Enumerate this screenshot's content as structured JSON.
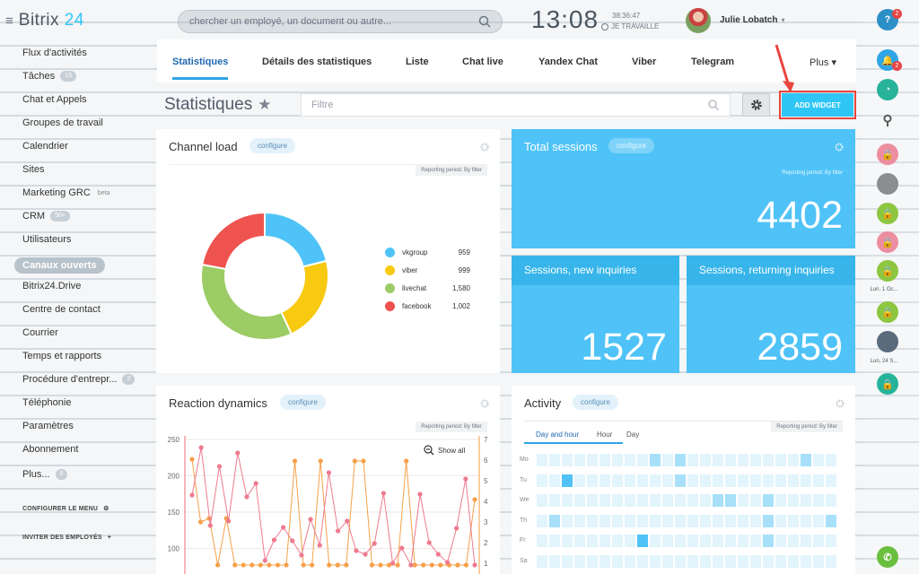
{
  "header": {
    "logo_word": "Bitrix",
    "logo_num": "24",
    "search_placeholder": "chercher un employé, un document ou autre...",
    "clock": "13:08",
    "seconds": "38:36:47",
    "work_status": "JE TRAVAILLE",
    "user_name": "Julie Lobatch"
  },
  "menu": {
    "items": [
      {
        "label": "Flux d'activités"
      },
      {
        "label": "Tâches",
        "count": "13"
      },
      {
        "label": "Chat et Appels"
      },
      {
        "label": "Groupes de travail"
      },
      {
        "label": "Calendrier"
      },
      {
        "label": "Sites"
      },
      {
        "label": "Marketing GRC",
        "sup": "beta"
      },
      {
        "label": "CRM",
        "count": "50+"
      },
      {
        "label": "Utilisateurs"
      },
      {
        "label": "Canaux ouverts",
        "active": true
      },
      {
        "label": "Bitrix24.Drive"
      },
      {
        "label": "Centre de contact"
      },
      {
        "label": "Courrier"
      },
      {
        "label": "Temps et rapports"
      },
      {
        "label": "Procédure d'entrepr...",
        "count": "2"
      },
      {
        "label": "Téléphonie"
      },
      {
        "label": "Paramètres"
      },
      {
        "label": "Abonnement"
      },
      {
        "label": "Plus...",
        "count": "8"
      }
    ],
    "configure": "CONFIGURER LE MENU",
    "invite": "INVITER DES EMPLOYÉS"
  },
  "tabs": [
    "Statistiques",
    "Détails des statistiques",
    "Liste",
    "Chat live",
    "Yandex Chat",
    "Viber",
    "Telegram",
    "Plus"
  ],
  "toolbar": {
    "title": "Statistiques",
    "filter_placeholder": "Filtre",
    "add_widget": "ADD WIDGET"
  },
  "widgets": {
    "configure": "configure",
    "reporting": "Reporting period: By filter",
    "channel_load": {
      "title": "Channel load",
      "legend": [
        {
          "name": "vkgroup",
          "value": "959",
          "color": "#4fc3f7"
        },
        {
          "name": "viber",
          "value": "999",
          "color": "#f7c910"
        },
        {
          "name": "livechat",
          "value": "1,580",
          "color": "#9ccc65"
        },
        {
          "name": "facebook",
          "value": "1,002",
          "color": "#ef5350"
        }
      ]
    },
    "total_sessions": {
      "title": "Total sessions",
      "value": "4402"
    },
    "new_inquiries": {
      "title": "Sessions, new inquiries",
      "value": "1527"
    },
    "returning_inquiries": {
      "title": "Sessions, returning inquiries",
      "value": "2859"
    },
    "reaction": {
      "title": "Reaction dynamics",
      "show_all": "Show all",
      "y_left": [
        "250",
        "200",
        "150",
        "100"
      ],
      "y_right": [
        "7",
        "6",
        "5",
        "4",
        "3",
        "2",
        "1"
      ]
    },
    "activity": {
      "title": "Activity",
      "subtabs": [
        "Day and hour",
        "Hour",
        "Day"
      ],
      "days": [
        "Mo",
        "Tu",
        "We",
        "Th",
        "Fr",
        "Sa"
      ]
    }
  },
  "rail": {
    "help_badge": "2",
    "bell_badge": "2",
    "date1": "Lun, 1 Oc...",
    "date2": "Lun, 24 S..."
  },
  "chart_data": {
    "type": "pie",
    "title": "Channel load",
    "categories": [
      "vkgroup",
      "viber",
      "livechat",
      "facebook"
    ],
    "values": [
      959,
      999,
      1580,
      1002
    ]
  }
}
